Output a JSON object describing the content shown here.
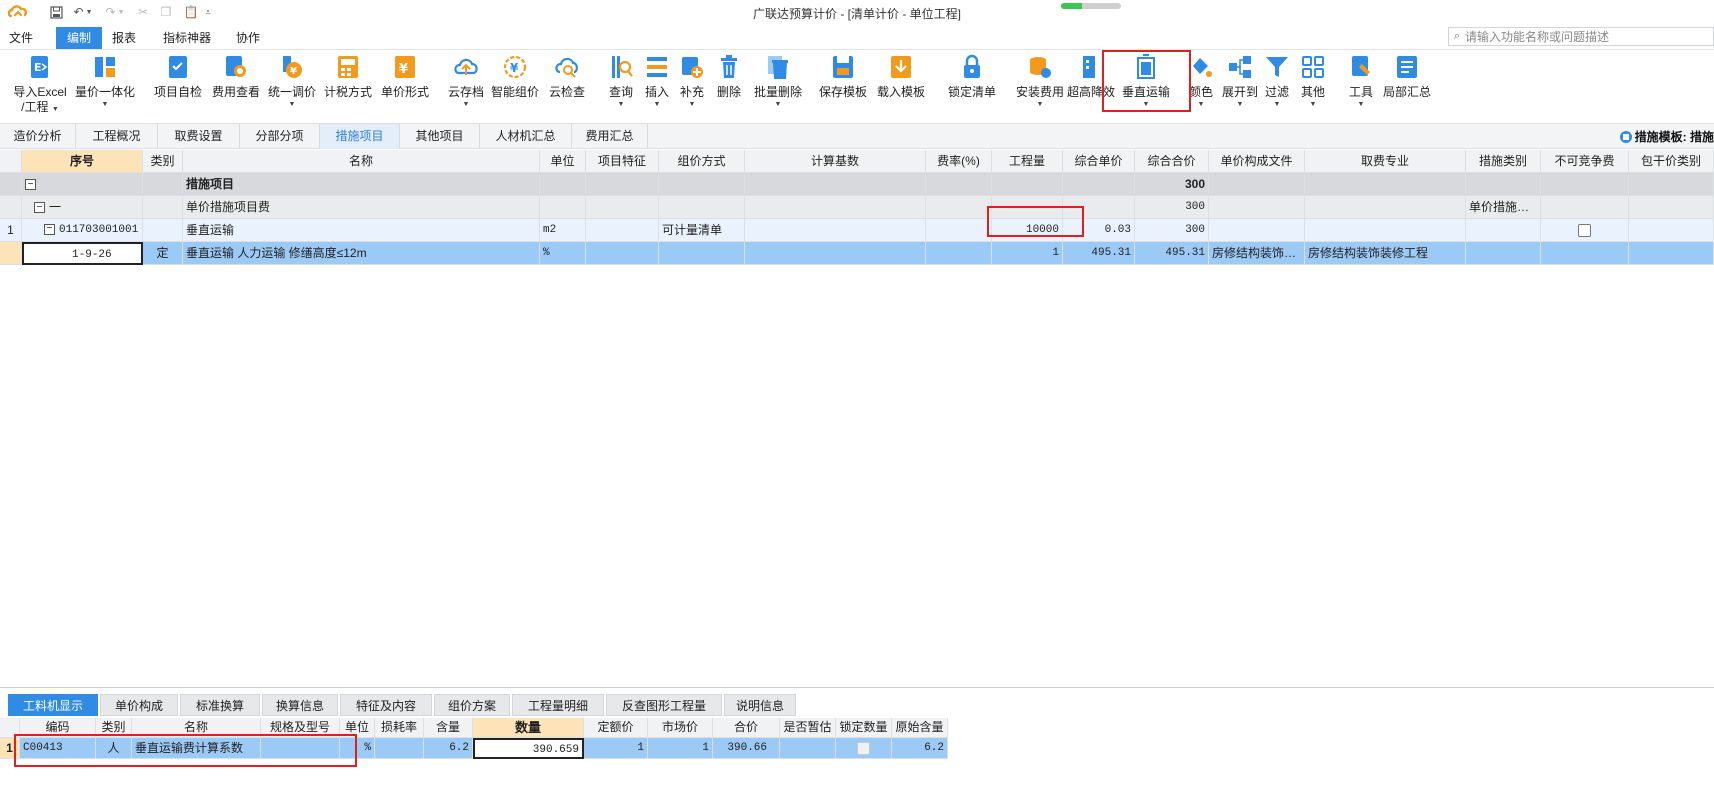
{
  "window": {
    "title": "广联达预算计价 - [清单计价 - 单位工程]",
    "progress_fraction": 0.35
  },
  "quick_access": {
    "save_icon": "save-icon",
    "undo_icon": "undo-icon",
    "redo_icon": "redo-icon",
    "cut_icon": "cut-icon",
    "copy_icon": "copy-icon",
    "paste_icon": "paste-icon",
    "customize_icon": "customize-icon"
  },
  "menu": {
    "items": [
      "文件",
      "编制",
      "报表",
      "指标神器",
      "协作"
    ],
    "active": "编制"
  },
  "search": {
    "placeholder": "请输入功能名称或问题描述"
  },
  "ribbon": {
    "tools": [
      {
        "line1": "导入Excel",
        "line2": "/工程",
        "dd": true
      },
      {
        "line1": "量价一体化",
        "dd": true
      },
      {
        "line1": "项目自检"
      },
      {
        "line1": "费用查看"
      },
      {
        "line1": "统一调价",
        "dd": true
      },
      {
        "line1": "计税方式"
      },
      {
        "line1": "单价形式"
      },
      {
        "line1": "云存档",
        "dd": true
      },
      {
        "line1": "智能组价"
      },
      {
        "line1": "云检查"
      },
      {
        "line1": "查询",
        "dd": true
      },
      {
        "line1": "插入",
        "dd": true
      },
      {
        "line1": "补充",
        "dd": true
      },
      {
        "line1": "删除"
      },
      {
        "line1": "批量删除",
        "dd": true
      },
      {
        "line1": "保存模板"
      },
      {
        "line1": "载入模板"
      },
      {
        "line1": "锁定清单"
      },
      {
        "line1": "安装费用",
        "dd": true
      },
      {
        "line1": "超高降效"
      },
      {
        "line1": "垂直运输",
        "dd": true
      },
      {
        "line1": "颜色",
        "dd": true
      },
      {
        "line1": "展开到",
        "dd": true
      },
      {
        "line1": "过滤",
        "dd": true
      },
      {
        "line1": "其他",
        "dd": true
      },
      {
        "line1": "工具",
        "dd": true
      },
      {
        "line1": "局部汇总"
      }
    ]
  },
  "tabs": {
    "items": [
      "造价分析",
      "工程概况",
      "取费设置",
      "分部分项",
      "措施项目",
      "其他项目",
      "人材机汇总",
      "费用汇总"
    ],
    "active": "措施项目",
    "template_label": "措施模板: 措施"
  },
  "main_table": {
    "headers": [
      "序号",
      "类别",
      "名称",
      "单位",
      "项目特征",
      "组价方式",
      "计算基数",
      "费率(%)",
      "工程量",
      "综合单价",
      "综合合价",
      "单价构成文件",
      "取费专业",
      "措施类别",
      "不可竞争费",
      "包干价类别"
    ],
    "rows": [
      {
        "num": "",
        "seq": "",
        "type": "",
        "name": "措施项目",
        "unit": "",
        "feature": "",
        "method": "",
        "base": "",
        "rate": "",
        "qty": "",
        "price": "",
        "total": "300",
        "file": "",
        "fee": "",
        "cat": "",
        "noncomp": "",
        "pkg": ""
      },
      {
        "num": "",
        "seq": "一",
        "type": "",
        "name": "单价措施项目费",
        "unit": "",
        "feature": "",
        "method": "",
        "base": "",
        "rate": "",
        "qty": "",
        "price": "",
        "total": "300",
        "file": "",
        "fee": "",
        "cat": "单价措施…",
        "noncomp": "",
        "pkg": ""
      },
      {
        "num": "1",
        "seq": "011703001001",
        "type": "",
        "name": "垂直运输",
        "unit": "m2",
        "feature": "",
        "method": "可计量清单",
        "base": "",
        "rate": "",
        "qty": "10000",
        "price": "0.03",
        "total": "300",
        "file": "",
        "fee": "",
        "cat": "",
        "noncomp": "",
        "pkg": ""
      },
      {
        "num": "",
        "seq": "1-9-26",
        "type": "定",
        "name": "垂直运输 人力运输 修缮高度≤12m",
        "unit": "%",
        "feature": "",
        "method": "",
        "base": "",
        "rate": "",
        "qty": "1",
        "price": "495.31",
        "total": "495.31",
        "file": "房修结构装饰…",
        "fee": "房修结构装饰装修工程",
        "cat": "",
        "noncomp": "",
        "pkg": ""
      }
    ]
  },
  "bottom_tabs": {
    "items": [
      "工料机显示",
      "单价构成",
      "标准换算",
      "换算信息",
      "特征及内容",
      "组价方案",
      "工程量明细",
      "反查图形工程量",
      "说明信息"
    ],
    "active": "工料机显示"
  },
  "bottom_table": {
    "headers": [
      "编码",
      "类别",
      "名称",
      "规格及型号",
      "单位",
      "损耗率",
      "含量",
      "数量",
      "定额价",
      "市场价",
      "合价",
      "是否暂估",
      "锁定数量",
      "原始含量"
    ],
    "rows": [
      {
        "num": "1",
        "code": "C00413",
        "type": "人",
        "name": "垂直运输费计算系数",
        "spec": "",
        "unit": "%",
        "loss": "",
        "content": "6.2",
        "qty": "390.659",
        "quota": "1",
        "market": "1",
        "total": "390.66",
        "est": "",
        "lock": "",
        "orig": "6.2"
      }
    ]
  },
  "colors": {
    "accent": "#2f8be4",
    "highlight": "#e02020",
    "selected_row": "#9ccaf6",
    "header_orange": "#fde3b8"
  }
}
